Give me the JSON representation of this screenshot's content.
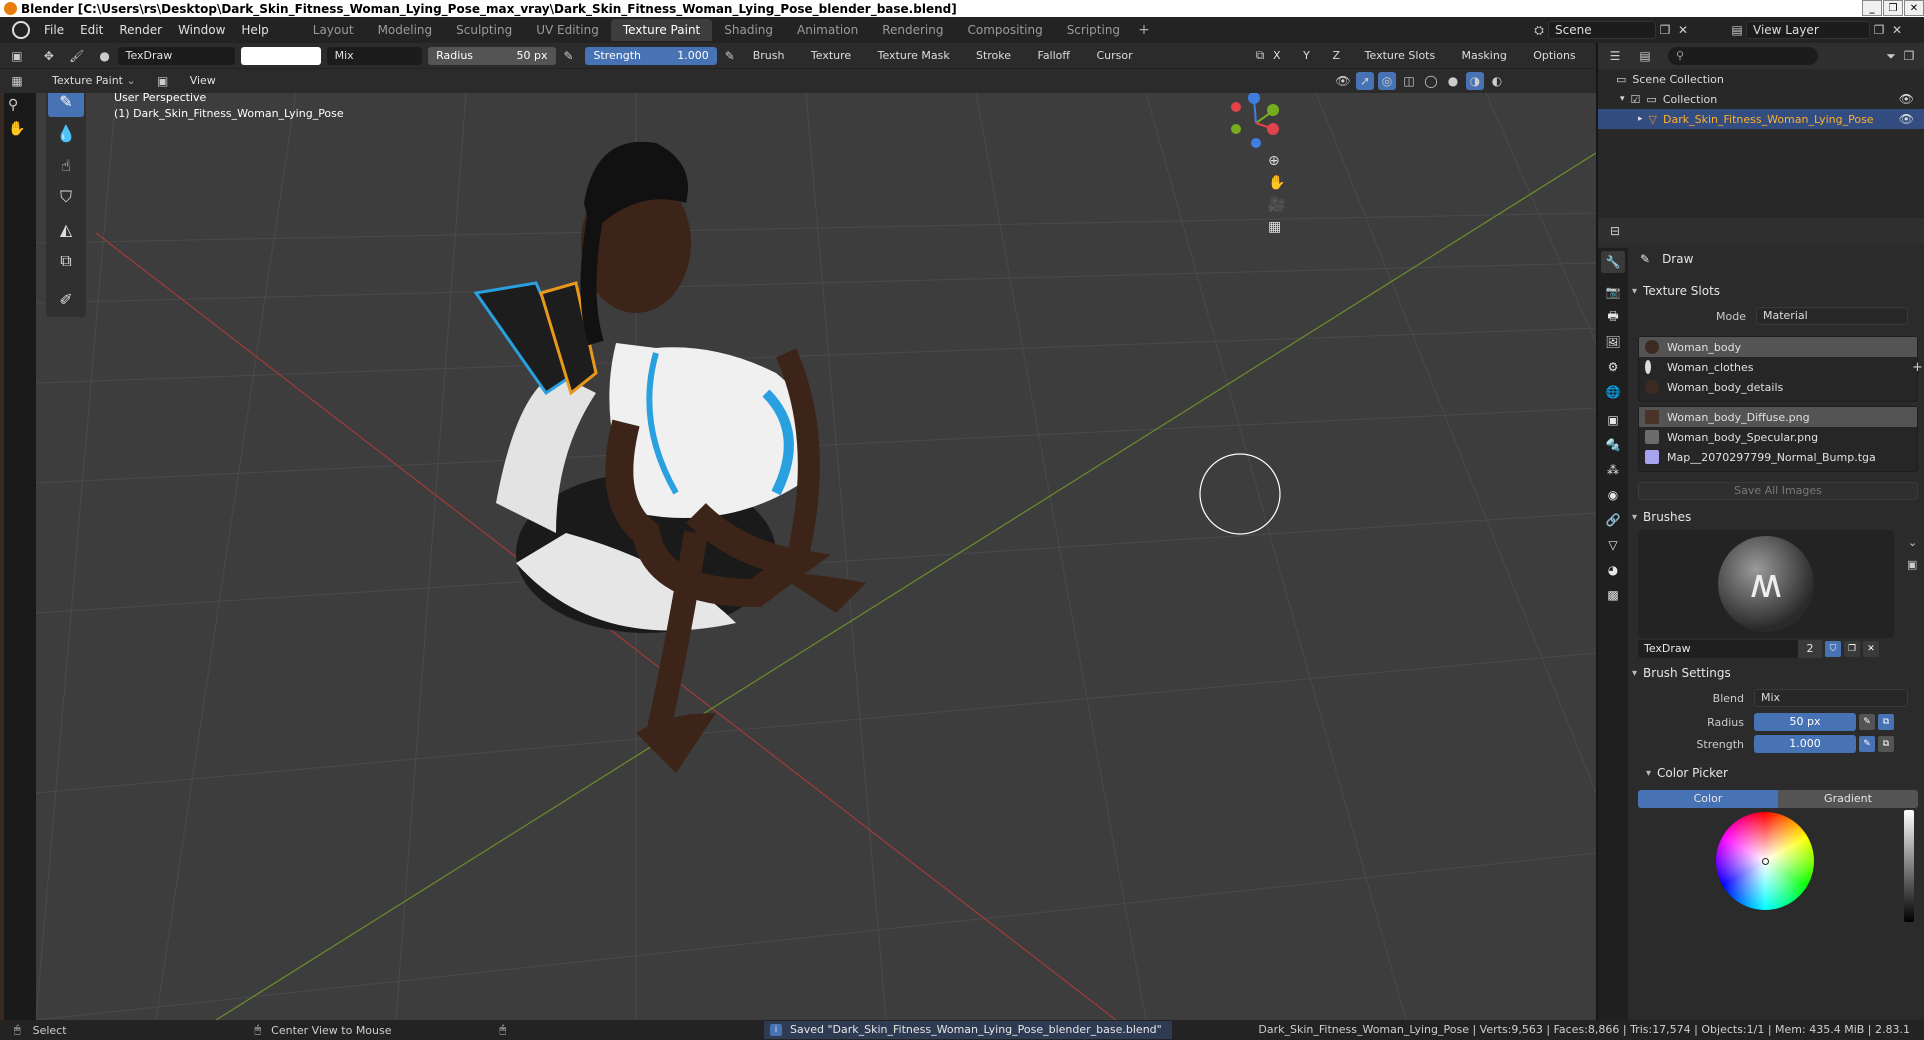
{
  "window": {
    "title": "Blender [C:\\Users\\rs\\Desktop\\Dark_Skin_Fitness_Woman_Lying_Pose_max_vray\\Dark_Skin_Fitness_Woman_Lying_Pose_blender_base.blend]",
    "controls": [
      "_",
      "❐",
      "✕"
    ]
  },
  "menu": [
    "File",
    "Edit",
    "Render",
    "Window",
    "Help"
  ],
  "workspaces": [
    "Layout",
    "Modeling",
    "Sculpting",
    "UV Editing",
    "Texture Paint",
    "Shading",
    "Animation",
    "Rendering",
    "Compositing",
    "Scripting"
  ],
  "active_workspace": "Texture Paint",
  "scene": {
    "scene_name": "Scene",
    "view_layer": "View Layer"
  },
  "tool_header": {
    "brush_name": "TexDraw",
    "blend_mode": "Mix",
    "radius_label": "Radius",
    "radius_value": "50 px",
    "strength_label": "Strength",
    "strength_value": "1.000",
    "menus": [
      "Brush",
      "Texture",
      "Texture Mask",
      "Stroke",
      "Falloff",
      "Cursor"
    ],
    "axes": [
      "X",
      "Y",
      "Z"
    ],
    "right_menus": [
      "Texture Slots",
      "Masking",
      "Options"
    ]
  },
  "header2": {
    "mode": "Texture Paint",
    "view": "View"
  },
  "viewport": {
    "perspective_label": "User Perspective",
    "object_label": "(1) Dark_Skin_Fitness_Woman_Lying_Pose",
    "gizmo": {
      "x": "X",
      "y": "Y",
      "z": "Z"
    }
  },
  "outliner": {
    "search_placeholder": "",
    "rows": [
      {
        "label": "Scene Collection"
      },
      {
        "label": "Collection"
      },
      {
        "label": "Dark_Skin_Fitness_Woman_Lying_Pose"
      }
    ]
  },
  "properties": {
    "tool_name": "Draw",
    "texture_slots": {
      "title": "Texture Slots",
      "mode_label": "Mode",
      "mode_value": "Material",
      "materials": [
        "Woman_body",
        "Woman_clothes",
        "Woman_body_details"
      ],
      "images": [
        "Woman_body_Diffuse.png",
        "Woman_body_Specular.png",
        "Map__2070297799_Normal_Bump.tga"
      ],
      "save_all": "Save All Images"
    },
    "brushes": {
      "title": "Brushes",
      "brush_name": "TexDraw",
      "users": "2"
    },
    "brush_settings": {
      "title": "Brush Settings",
      "blend_label": "Blend",
      "blend_value": "Mix",
      "radius_label": "Radius",
      "radius_value": "50 px",
      "strength_label": "Strength",
      "strength_value": "1.000"
    },
    "color_picker": {
      "title": "Color Picker",
      "tab_color": "Color",
      "tab_gradient": "Gradient"
    }
  },
  "statusbar": {
    "select": "Select",
    "center_view": "Center View to Mouse",
    "message": "Saved \"Dark_Skin_Fitness_Woman_Lying_Pose_blender_base.blend\"",
    "stats": "Dark_Skin_Fitness_Woman_Lying_Pose | Verts:9,563 | Faces:8,866 | Tris:17,574 | Objects:1/1 | Mem: 435.4 MiB | 2.83.1"
  },
  "colors": {
    "accent": "#4772b3",
    "selection": "#334d80",
    "x_axis": "#e2434b",
    "y_axis": "#76ad1e",
    "z_axis": "#3f7ee0"
  }
}
